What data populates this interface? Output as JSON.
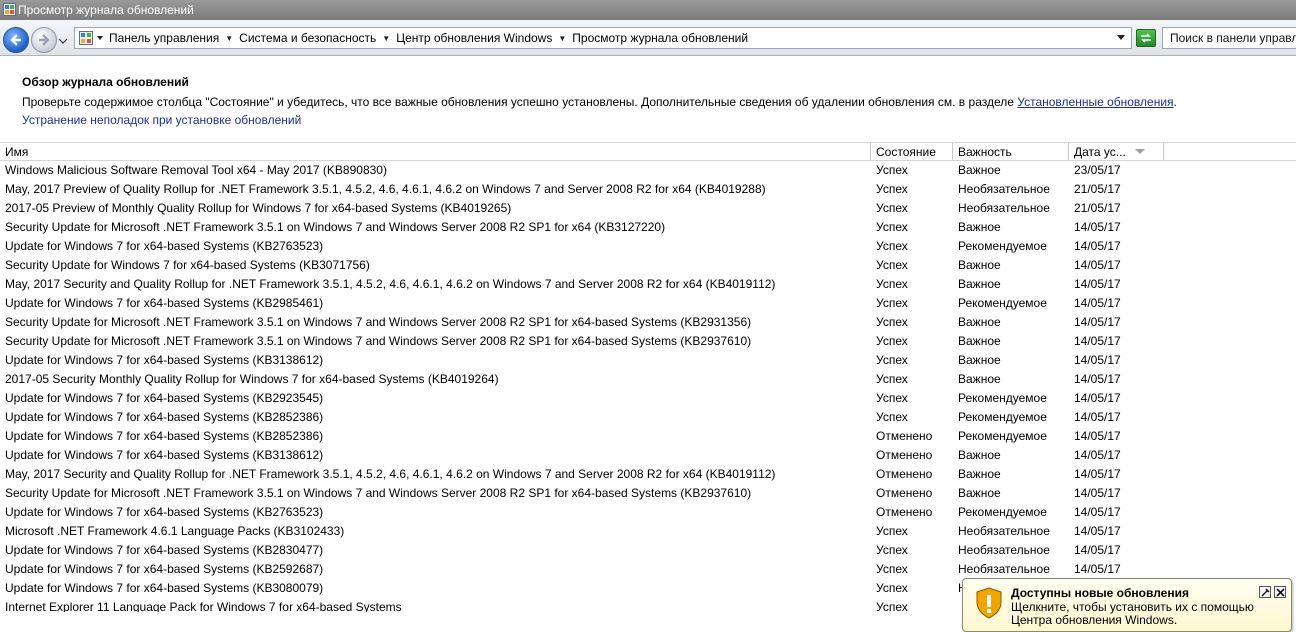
{
  "window": {
    "title": "Просмотр журнала обновлений"
  },
  "address": {
    "crumbs": [
      "Панель управления",
      "Система и безопасность",
      "Центр обновления Windows",
      "Просмотр журнала обновлений"
    ],
    "search_placeholder": "Поиск в панели управления"
  },
  "content": {
    "heading": "Обзор журнала обновлений",
    "desc_text": "Проверьте содержимое столбца \"Состояние\" и убедитесь, что все важные обновления успешно установлены. Дополнительные сведения об удалении обновления см. в разделе ",
    "desc_link": "Установленные обновления",
    "desc_end": ".",
    "troubleshoot_link": "Устранение неполадок при установке обновлений"
  },
  "table": {
    "columns": {
      "name": "Имя",
      "status": "Состояние",
      "importance": "Важность",
      "date": "Дата ус..."
    },
    "rows": [
      {
        "name": "Windows Malicious Software Removal Tool x64 - May 2017 (KB890830)",
        "status": "Успех",
        "importance": "Важное",
        "date": "23/05/17"
      },
      {
        "name": "May, 2017 Preview of Quality Rollup for .NET Framework 3.5.1, 4.5.2, 4.6, 4.6.1, 4.6.2 on Windows 7 and Server 2008 R2 for x64 (KB4019288)",
        "status": "Успех",
        "importance": "Необязательное",
        "date": "21/05/17"
      },
      {
        "name": "2017-05 Preview of Monthly Quality Rollup for Windows 7 for x64-based Systems (KB4019265)",
        "status": "Успех",
        "importance": "Необязательное",
        "date": "21/05/17"
      },
      {
        "name": "Security Update for Microsoft .NET Framework 3.5.1 on Windows 7 and Windows Server 2008 R2 SP1 for x64 (KB3127220)",
        "status": "Успех",
        "importance": "Важное",
        "date": "14/05/17"
      },
      {
        "name": "Update for Windows 7 for x64-based Systems (KB2763523)",
        "status": "Успех",
        "importance": "Рекомендуемое",
        "date": "14/05/17"
      },
      {
        "name": "Security Update for Windows 7 for x64-based Systems (KB3071756)",
        "status": "Успех",
        "importance": "Важное",
        "date": "14/05/17"
      },
      {
        "name": "May, 2017 Security and Quality Rollup for .NET Framework 3.5.1, 4.5.2, 4.6, 4.6.1, 4.6.2 on Windows 7 and Server 2008 R2 for x64 (KB4019112)",
        "status": "Успех",
        "importance": "Важное",
        "date": "14/05/17"
      },
      {
        "name": "Update for Windows 7 for x64-based Systems (KB2985461)",
        "status": "Успех",
        "importance": "Рекомендуемое",
        "date": "14/05/17"
      },
      {
        "name": "Security Update for Microsoft .NET Framework 3.5.1 on Windows 7 and Windows Server 2008 R2 SP1 for x64-based Systems (KB2931356)",
        "status": "Успех",
        "importance": "Важное",
        "date": "14/05/17"
      },
      {
        "name": "Security Update for Microsoft .NET Framework 3.5.1 on Windows 7 and Windows Server 2008 R2 SP1 for x64-based Systems (KB2937610)",
        "status": "Успех",
        "importance": "Важное",
        "date": "14/05/17"
      },
      {
        "name": "Update for Windows 7 for x64-based Systems (KB3138612)",
        "status": "Успех",
        "importance": "Важное",
        "date": "14/05/17"
      },
      {
        "name": "2017-05 Security Monthly Quality Rollup for Windows 7 for x64-based Systems (KB4019264)",
        "status": "Успех",
        "importance": "Важное",
        "date": "14/05/17"
      },
      {
        "name": "Update for Windows 7 for x64-based Systems (KB2923545)",
        "status": "Успех",
        "importance": "Рекомендуемое",
        "date": "14/05/17"
      },
      {
        "name": "Update for Windows 7 for x64-based Systems (KB2852386)",
        "status": "Успех",
        "importance": "Рекомендуемое",
        "date": "14/05/17"
      },
      {
        "name": "Update for Windows 7 for x64-based Systems (KB2852386)",
        "status": "Отменено",
        "importance": "Рекомендуемое",
        "date": "14/05/17"
      },
      {
        "name": "Update for Windows 7 for x64-based Systems (KB3138612)",
        "status": "Отменено",
        "importance": "Важное",
        "date": "14/05/17"
      },
      {
        "name": "May, 2017 Security and Quality Rollup for .NET Framework 3.5.1, 4.5.2, 4.6, 4.6.1, 4.6.2 on Windows 7 and Server 2008 R2 for x64 (KB4019112)",
        "status": "Отменено",
        "importance": "Важное",
        "date": "14/05/17"
      },
      {
        "name": "Security Update for Microsoft .NET Framework 3.5.1 on Windows 7 and Windows Server 2008 R2 SP1 for x64-based Systems (KB2937610)",
        "status": "Отменено",
        "importance": "Важное",
        "date": "14/05/17"
      },
      {
        "name": "Update for Windows 7 for x64-based Systems (KB2763523)",
        "status": "Отменено",
        "importance": "Рекомендуемое",
        "date": "14/05/17"
      },
      {
        "name": "Microsoft .NET Framework 4.6.1 Language Packs (KB3102433)",
        "status": "Успех",
        "importance": "Необязательное",
        "date": "14/05/17"
      },
      {
        "name": "Update for Windows 7 for x64-based Systems (KB2830477)",
        "status": "Успех",
        "importance": "Необязательное",
        "date": "14/05/17"
      },
      {
        "name": "Update for Windows 7 for x64-based Systems (KB2592687)",
        "status": "Успех",
        "importance": "Необязательное",
        "date": "14/05/17"
      },
      {
        "name": "Update for Windows 7 for x64-based Systems (KB3080079)",
        "status": "Успех",
        "importance": "Н",
        "date": ""
      },
      {
        "name": "Internet Explorer 11 Language Pack for Windows 7 for x64-based Systems",
        "status": "Успех",
        "importance": "",
        "date": ""
      }
    ]
  },
  "notification": {
    "title": "Доступны новые обновления",
    "text": "Щелкните, чтобы установить их с помощью Центра обновления Windows."
  },
  "colors": {
    "link": "#1e3287",
    "titlebar": "#8a8a8a",
    "balloon_bg": "#fffbe0"
  }
}
